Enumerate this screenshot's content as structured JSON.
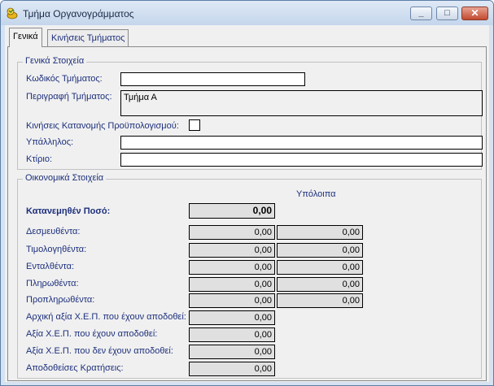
{
  "window": {
    "title": "Τμήμα Οργανογράμματος"
  },
  "tabs": [
    {
      "label": "Γενικά"
    },
    {
      "label": "Κινήσεις Τμήματος"
    }
  ],
  "general": {
    "legend": "Γενικά Στοιχεία",
    "code_label": "Κωδικός Τμήματος:",
    "code_value": "",
    "desc_label": "Περιγραφή Τμήματος:",
    "desc_value": "Τμήμα Α",
    "budget_label": "Κινήσεις Κατανομής Προϋπολογισμού:",
    "budget_checked": false,
    "employee_label": "Υπάλληλος:",
    "employee_value": "",
    "building_label": "Κτίριο:",
    "building_value": ""
  },
  "financial": {
    "legend": "Οικονομικά Στοιχεία",
    "balances_header": "Υπόλοιπα",
    "allocated_label": "Κατανεμηθέν Ποσό:",
    "allocated_value": "0,00",
    "rows": [
      {
        "label": "Δεσμευθέντα:",
        "value": "0,00",
        "balance": "0,00"
      },
      {
        "label": "Τιμολογηθέντα:",
        "value": "0,00",
        "balance": "0,00"
      },
      {
        "label": "Ενταλθέντα:",
        "value": "0,00",
        "balance": "0,00"
      },
      {
        "label": "Πληρωθέντα:",
        "value": "0,00",
        "balance": "0,00"
      },
      {
        "label": "Προπληρωθέντα:",
        "value": "0,00",
        "balance": "0,00"
      }
    ],
    "single_rows": [
      {
        "label": "Αρχική αξία Χ.Ε.Π. που έχουν αποδοθεί:",
        "value": "0,00"
      },
      {
        "label": "Αξία Χ.Ε.Π. που έχουν αποδοθεί:",
        "value": "0,00"
      },
      {
        "label": "Αξία Χ.Ε.Π. που δεν έχουν αποδοθεί:",
        "value": "0,00"
      },
      {
        "label": "Αποδοθείσες Κρατήσεις:",
        "value": "0,00"
      }
    ]
  }
}
